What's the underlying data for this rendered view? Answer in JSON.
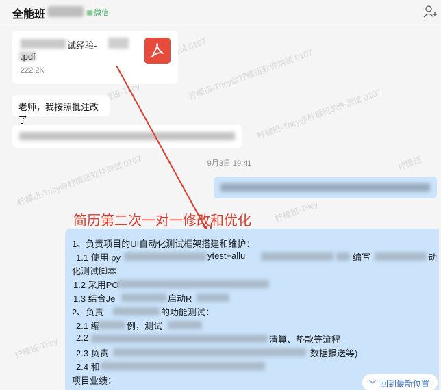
{
  "header": {
    "title": "全能班",
    "tag": "微信"
  },
  "file": {
    "name_visible": "试经验-",
    "ext": ".pdf",
    "size": "222.2K"
  },
  "messages": {
    "msg1": "老师，我按照批注改了",
    "time": "9月3日 19:41"
  },
  "annotation": "简历第二次一对一修改和优化",
  "resume": {
    "lines": [
      "1、负责项目的UI自动化测试框架搭建和维护：",
      "1.1 使用 py",
      "ytest+allu",
      "编写",
      "动",
      "化测试脚本",
      "1.2 采用PO",
      "1.3 结合Je",
      "启动R",
      "2、负责",
      "的功能测试：",
      "2.1 编",
      "例，测试",
      "2.2",
      "清算、垫款等流程",
      "2.3 负责",
      "数据报送等)",
      "2.4 和",
      "项目业绩："
    ]
  },
  "jump_button": "回到最新位置",
  "watermark": [
    "柠檬班-Tricy@柠檬班软件测试 0107",
    "柠檬班-Tricy",
    "0107",
    "tricy"
  ],
  "colors": {
    "outgoing_bubble": "#cbe4fb",
    "annotation_red": "#e03b2c",
    "link_blue": "#3b6fc5",
    "pdf_red": "#e74b3c"
  }
}
